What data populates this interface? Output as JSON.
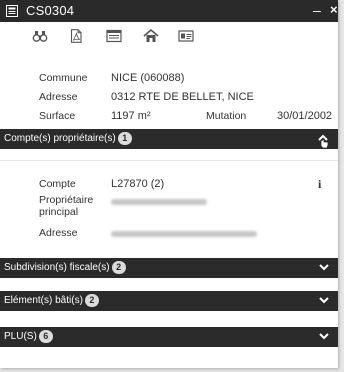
{
  "window": {
    "title": "CS0304",
    "minimize_label": "–",
    "close_label": "×"
  },
  "toolbar": {
    "icons": [
      "binoculars-icon",
      "pdf-icon",
      "list-icon",
      "home-icon",
      "card-icon"
    ]
  },
  "parcel": {
    "commune_label": "Commune",
    "commune_value": "NICE (060088)",
    "adresse_label": "Adresse",
    "adresse_value": "0312 RTE DE BELLET, NICE",
    "surface_label": "Surface",
    "surface_value": "1197 m²",
    "mutation_label": "Mutation",
    "mutation_date": "30/01/2002"
  },
  "sections": {
    "owners": {
      "label": "Compte(s) propriétaire(s)",
      "count": "1",
      "expanded": true
    },
    "subdivisions": {
      "label": "Subdivision(s) fiscale(s)",
      "count": "2"
    },
    "buildings": {
      "label": "Elément(s) bâti(s)",
      "count": "2"
    },
    "plu": {
      "label": "PLU(S)",
      "count": "6"
    }
  },
  "owner": {
    "compte_label": "Compte",
    "compte_value": "L27870 (2)",
    "proprietaire_label_line1": "Propriétaire",
    "proprietaire_label_line2": "principal",
    "adresse_label": "Adresse",
    "info_label": "i"
  },
  "colors": {
    "titlebar": "#2a2a2a",
    "section_bar": "#2b2b2b",
    "badge_bg": "#dcdcdc",
    "text": "#333333"
  }
}
